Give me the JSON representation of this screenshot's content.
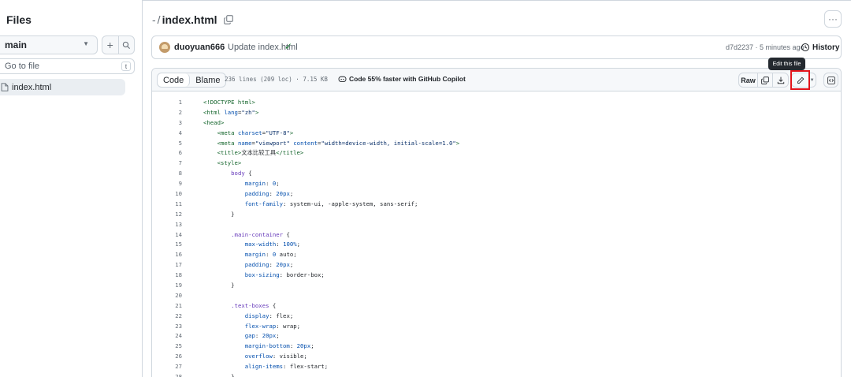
{
  "sidebar": {
    "title": "Files",
    "branch": "main",
    "add_label": "+",
    "goto_placeholder": "Go to file",
    "goto_shortcut": "t",
    "files": [
      {
        "name": "index.html"
      }
    ]
  },
  "header": {
    "breadcrumb_root": "-",
    "breadcrumb_sep": "/",
    "file_name": "index.html",
    "more_label": "···"
  },
  "commit": {
    "author": "duoyuan666",
    "message": "Update index.html",
    "hash_time": "d7d2237 · 5 minutes ago",
    "history_label": "History"
  },
  "tooltip": "Edit this file",
  "code_header": {
    "tab_code": "Code",
    "tab_blame": "Blame",
    "lines_info": "236 lines (209 loc) · 7.15 KB",
    "copilot": "Code 55% faster with GitHub Copilot",
    "raw_label": "Raw"
  },
  "code_lines": [
    {
      "n": "1",
      "html": "<span class=\"tag\">&lt;!DOCTYPE html&gt;</span>"
    },
    {
      "n": "2",
      "html": "<span class=\"tag\">&lt;html</span> <span class=\"attr\">lang</span>=<span class=\"str\">\"zh\"</span><span class=\"tag\">&gt;</span>"
    },
    {
      "n": "3",
      "html": "<span class=\"tag\">&lt;head&gt;</span>"
    },
    {
      "n": "4",
      "html": "    <span class=\"tag\">&lt;meta</span> <span class=\"attr\">charset</span>=<span class=\"str\">\"UTF-8\"</span><span class=\"tag\">&gt;</span>"
    },
    {
      "n": "5",
      "html": "    <span class=\"tag\">&lt;meta</span> <span class=\"attr\">name</span>=<span class=\"str\">\"viewport\"</span> <span class=\"attr\">content</span>=<span class=\"str\">\"width=device-width, initial-scale=1.0\"</span><span class=\"tag\">&gt;</span>"
    },
    {
      "n": "6",
      "html": "    <span class=\"tag\">&lt;title&gt;</span>文本比较工具<span class=\"tag\">&lt;/title&gt;</span>"
    },
    {
      "n": "7",
      "html": "    <span class=\"tag\">&lt;style&gt;</span>"
    },
    {
      "n": "8",
      "html": "        <span class=\"sel\">body</span> {"
    },
    {
      "n": "9",
      "html": "            <span class=\"prop\">margin</span>: <span class=\"num\">0</span>;"
    },
    {
      "n": "10",
      "html": "            <span class=\"prop\">padding</span>: <span class=\"num\">20px</span>;"
    },
    {
      "n": "11",
      "html": "            <span class=\"prop\">font-family</span>: system-ui, -apple-system, sans-serif;"
    },
    {
      "n": "12",
      "html": "        }"
    },
    {
      "n": "13",
      "html": ""
    },
    {
      "n": "14",
      "html": "        <span class=\"sel\">.main-container</span> {"
    },
    {
      "n": "15",
      "html": "            <span class=\"prop\">max-width</span>: <span class=\"num\">100%</span>;"
    },
    {
      "n": "16",
      "html": "            <span class=\"prop\">margin</span>: <span class=\"num\">0</span> auto;"
    },
    {
      "n": "17",
      "html": "            <span class=\"prop\">padding</span>: <span class=\"num\">20px</span>;"
    },
    {
      "n": "18",
      "html": "            <span class=\"prop\">box-sizing</span>: border-box;"
    },
    {
      "n": "19",
      "html": "        }"
    },
    {
      "n": "20",
      "html": ""
    },
    {
      "n": "21",
      "html": "        <span class=\"sel\">.text-boxes</span> {"
    },
    {
      "n": "22",
      "html": "            <span class=\"prop\">display</span>: flex;"
    },
    {
      "n": "23",
      "html": "            <span class=\"prop\">flex-wrap</span>: wrap;"
    },
    {
      "n": "24",
      "html": "            <span class=\"prop\">gap</span>: <span class=\"num\">20px</span>;"
    },
    {
      "n": "25",
      "html": "            <span class=\"prop\">margin-bottom</span>: <span class=\"num\">20px</span>;"
    },
    {
      "n": "26",
      "html": "            <span class=\"prop\">overflow</span>: visible;"
    },
    {
      "n": "27",
      "html": "            <span class=\"prop\">align-items</span>: flex-start;"
    },
    {
      "n": "28",
      "html": "        }"
    }
  ]
}
